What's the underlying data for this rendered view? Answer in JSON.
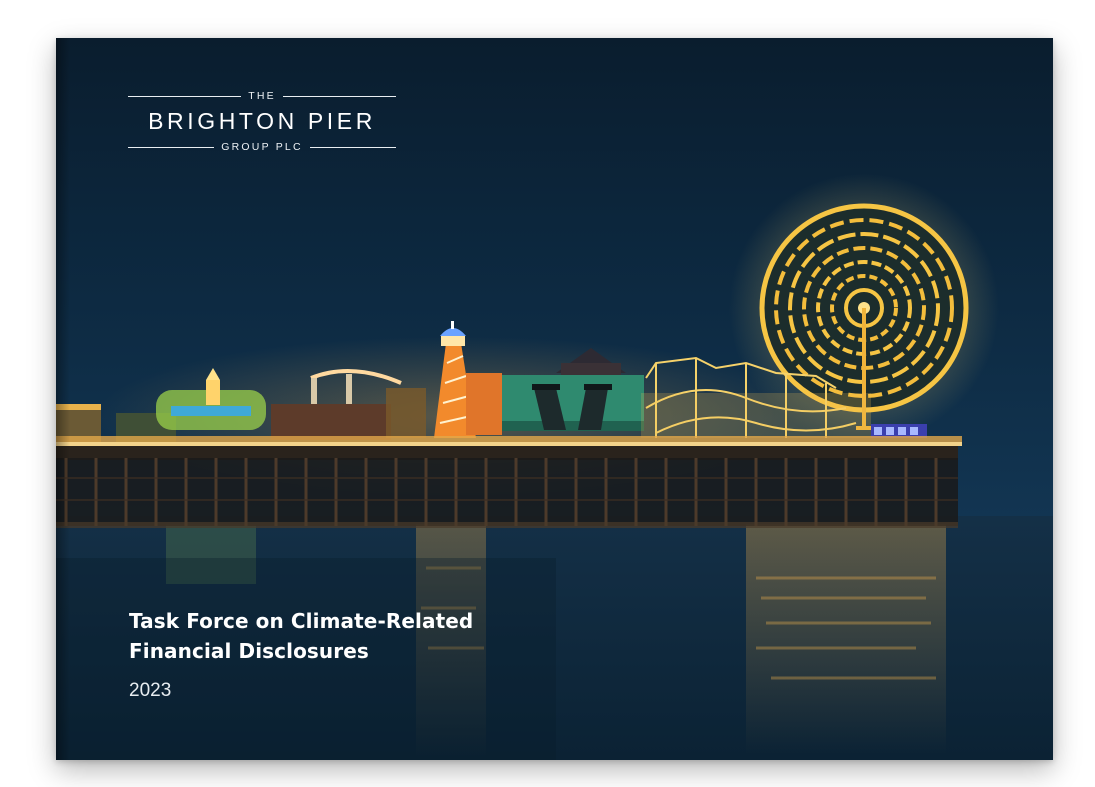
{
  "logo": {
    "prefix": "THE",
    "name": "BRIGHTON PIER",
    "suffix": "GROUP PLC"
  },
  "title": {
    "line1": "Task Force on Climate-Related",
    "line2": "Financial Disclosures"
  },
  "year": "2023",
  "colors": {
    "sky": "#0b2032",
    "sea": "#0f2a3d",
    "lights": "#f2c14e",
    "text": "#ffffff"
  }
}
